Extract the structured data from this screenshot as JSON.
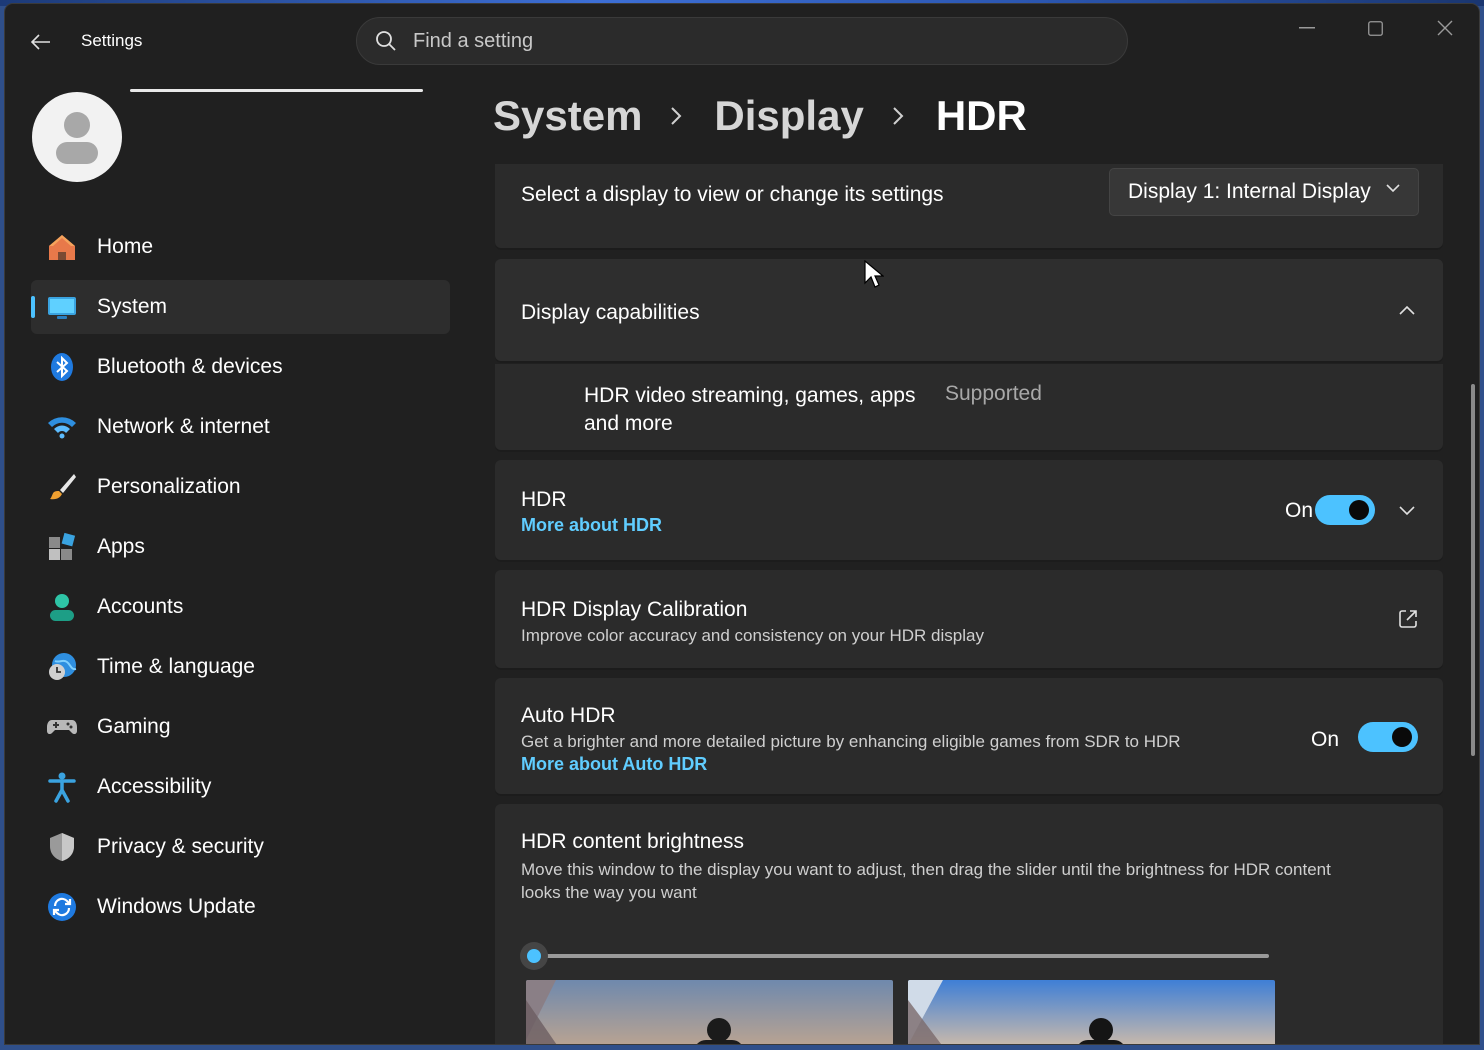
{
  "window": {
    "title": "Settings",
    "search_placeholder": "Find a setting"
  },
  "user": {
    "avatar_icon": "person-icon"
  },
  "sidebar": {
    "items": [
      {
        "label": "Home",
        "icon": "home-icon",
        "active": false
      },
      {
        "label": "System",
        "icon": "system-icon",
        "active": true
      },
      {
        "label": "Bluetooth & devices",
        "icon": "bluetooth-icon",
        "active": false
      },
      {
        "label": "Network & internet",
        "icon": "wifi-icon",
        "active": false
      },
      {
        "label": "Personalization",
        "icon": "brush-icon",
        "active": false
      },
      {
        "label": "Apps",
        "icon": "apps-icon",
        "active": false
      },
      {
        "label": "Accounts",
        "icon": "accounts-icon",
        "active": false
      },
      {
        "label": "Time & language",
        "icon": "clock-globe-icon",
        "active": false
      },
      {
        "label": "Gaming",
        "icon": "gamepad-icon",
        "active": false
      },
      {
        "label": "Accessibility",
        "icon": "accessibility-icon",
        "active": false
      },
      {
        "label": "Privacy & security",
        "icon": "shield-icon",
        "active": false
      },
      {
        "label": "Windows Update",
        "icon": "update-icon",
        "active": false
      }
    ]
  },
  "breadcrumb": {
    "items": [
      "System",
      "Display",
      "HDR"
    ]
  },
  "display_select": {
    "label": "Select a display to view or change its settings",
    "value": "Display 1: Internal Display"
  },
  "capabilities": {
    "title": "Display capabilities",
    "row_label_line1": "HDR video streaming, games, apps",
    "row_label_line2": "and more",
    "row_value": "Supported",
    "expanded": true
  },
  "hdr": {
    "title": "HDR",
    "link": "More about HDR",
    "state_label": "On",
    "enabled": true
  },
  "calibration": {
    "title": "HDR Display Calibration",
    "desc": "Improve color accuracy and consistency on your HDR display"
  },
  "auto_hdr": {
    "title": "Auto HDR",
    "desc": "Get a brighter and more detailed picture by enhancing eligible games from SDR to HDR",
    "link": "More about Auto HDR",
    "state_label": "On",
    "enabled": true
  },
  "brightness": {
    "title": "HDR content brightness",
    "desc_line1": "Move this window to the display you want to adjust, then drag the slider until the brightness for HDR content",
    "desc_line2": "looks the way you want",
    "slider_value": 0
  },
  "colors": {
    "accent": "#4cc2ff",
    "link": "#60cdff",
    "background": "#202020",
    "card": "#2b2b2b"
  }
}
